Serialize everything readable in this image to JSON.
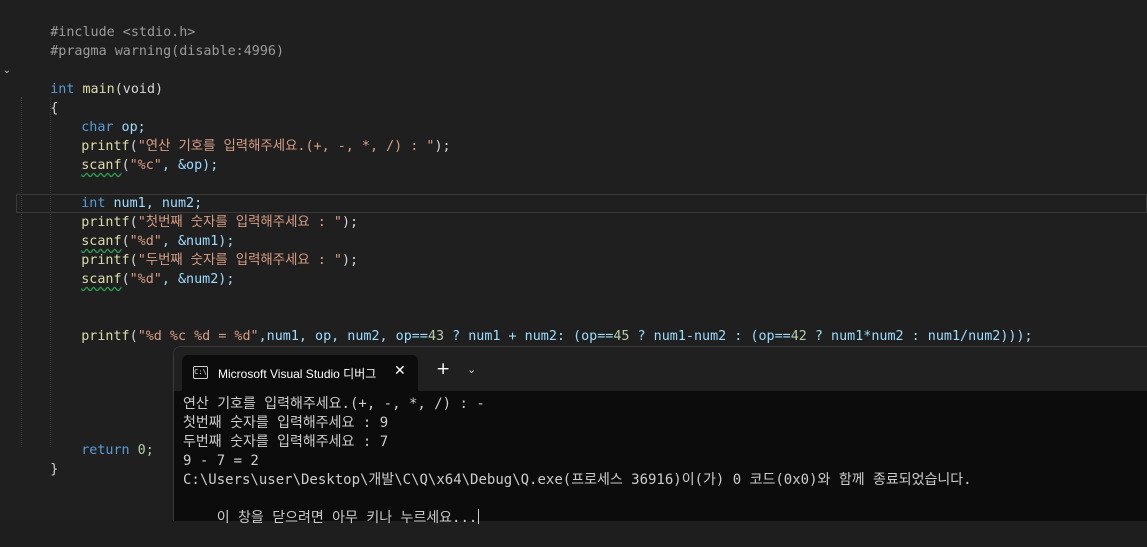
{
  "editor": {
    "include_line": "#include <stdio.h>",
    "pragma_line": "#pragma warning(disable:4996)",
    "main_sig_kw": "int",
    "main_sig_name": "main",
    "main_sig_args": "(void)",
    "open_brace": "{",
    "close_brace": "}",
    "l_char": "char",
    "l_op_decl": " op;",
    "l_printf1_fn": "printf",
    "l_printf1_str": "\"연산 기호를 입력해주세요.(+, -, *, /) : \"",
    "l_printf1_end": ");",
    "l_scanf1_fn": "scanf",
    "l_scanf1_open": "(",
    "l_scanf1_str": "\"%c\"",
    "l_scanf1_args": ", &op);",
    "l_int2": "int",
    "l_num_decl": " num1, num2;",
    "l_printf2_fn": "printf",
    "l_printf2_str": "\"첫번째 숫자를 입력해주세요 : \"",
    "l_printf2_end": ");",
    "l_scanf2_fn": "scanf",
    "l_scanf2_open": "(",
    "l_scanf2_str": "\"%d\"",
    "l_scanf2_args": ", &num1);",
    "l_printf3_fn": "printf",
    "l_printf3_str": "\"두번째 숫자를 입력해주세요 : \"",
    "l_printf3_end": ");",
    "l_scanf3_fn": "scanf",
    "l_scanf3_open": "(",
    "l_scanf3_str": "\"%d\"",
    "l_scanf3_args": ", &num2);",
    "l_final_fn": "printf",
    "l_final_open": "(",
    "l_final_str": "\"%d %c %d = %d\"",
    "l_final_a": ",num1, op, num2, op==",
    "l_final_n43": "43",
    "l_final_b": " ? num1 + num2: (op==",
    "l_final_n45": "45",
    "l_final_c": " ? num1-num2 : (op==",
    "l_final_n42": "42",
    "l_final_d": " ? num1*num2 : num1/num2)));",
    "l_return_kw": "return",
    "l_return_val": " 0;"
  },
  "terminal": {
    "tab_title": "Microsoft Visual Studio 디버그",
    "tab_icon": "C:\\",
    "close_glyph": "✕",
    "new_tab_glyph": "+",
    "dropdown_glyph": "⌄",
    "lines": [
      "연산 기호를 입력해주세요.(+, -, *, /) : -",
      "첫번째 숫자를 입력해주세요 : 9",
      "두번째 숫자를 입력해주세요 : 7",
      "9 - 7 = 2",
      "C:\\Users\\user\\Desktop\\개발\\C\\Q\\x64\\Debug\\Q.exe(프로세스 36916)이(가) 0 코드(0x0)와 함께 종료되었습니다.",
      "이 창을 닫으려면 아무 키나 누르세요..."
    ]
  }
}
